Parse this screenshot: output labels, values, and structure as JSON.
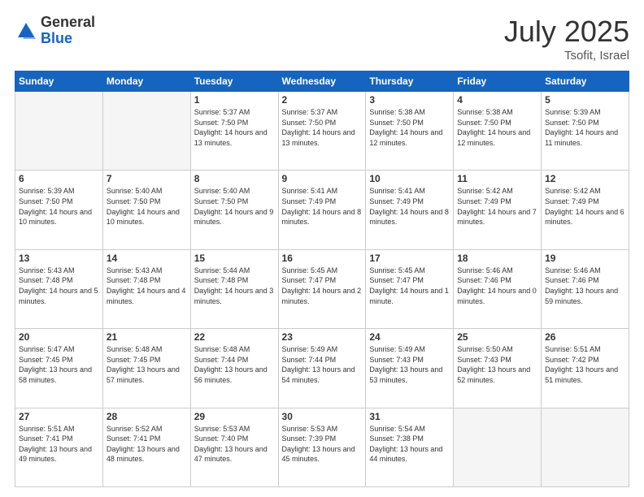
{
  "header": {
    "logo_general": "General",
    "logo_blue": "Blue",
    "title": "July 2025",
    "location": "Tsofit, Israel"
  },
  "days_of_week": [
    "Sunday",
    "Monday",
    "Tuesday",
    "Wednesday",
    "Thursday",
    "Friday",
    "Saturday"
  ],
  "weeks": [
    [
      {
        "day": "",
        "info": ""
      },
      {
        "day": "",
        "info": ""
      },
      {
        "day": "1",
        "info": "Sunrise: 5:37 AM\nSunset: 7:50 PM\nDaylight: 14 hours and 13 minutes."
      },
      {
        "day": "2",
        "info": "Sunrise: 5:37 AM\nSunset: 7:50 PM\nDaylight: 14 hours and 13 minutes."
      },
      {
        "day": "3",
        "info": "Sunrise: 5:38 AM\nSunset: 7:50 PM\nDaylight: 14 hours and 12 minutes."
      },
      {
        "day": "4",
        "info": "Sunrise: 5:38 AM\nSunset: 7:50 PM\nDaylight: 14 hours and 12 minutes."
      },
      {
        "day": "5",
        "info": "Sunrise: 5:39 AM\nSunset: 7:50 PM\nDaylight: 14 hours and 11 minutes."
      }
    ],
    [
      {
        "day": "6",
        "info": "Sunrise: 5:39 AM\nSunset: 7:50 PM\nDaylight: 14 hours and 10 minutes."
      },
      {
        "day": "7",
        "info": "Sunrise: 5:40 AM\nSunset: 7:50 PM\nDaylight: 14 hours and 10 minutes."
      },
      {
        "day": "8",
        "info": "Sunrise: 5:40 AM\nSunset: 7:50 PM\nDaylight: 14 hours and 9 minutes."
      },
      {
        "day": "9",
        "info": "Sunrise: 5:41 AM\nSunset: 7:49 PM\nDaylight: 14 hours and 8 minutes."
      },
      {
        "day": "10",
        "info": "Sunrise: 5:41 AM\nSunset: 7:49 PM\nDaylight: 14 hours and 8 minutes."
      },
      {
        "day": "11",
        "info": "Sunrise: 5:42 AM\nSunset: 7:49 PM\nDaylight: 14 hours and 7 minutes."
      },
      {
        "day": "12",
        "info": "Sunrise: 5:42 AM\nSunset: 7:49 PM\nDaylight: 14 hours and 6 minutes."
      }
    ],
    [
      {
        "day": "13",
        "info": "Sunrise: 5:43 AM\nSunset: 7:48 PM\nDaylight: 14 hours and 5 minutes."
      },
      {
        "day": "14",
        "info": "Sunrise: 5:43 AM\nSunset: 7:48 PM\nDaylight: 14 hours and 4 minutes."
      },
      {
        "day": "15",
        "info": "Sunrise: 5:44 AM\nSunset: 7:48 PM\nDaylight: 14 hours and 3 minutes."
      },
      {
        "day": "16",
        "info": "Sunrise: 5:45 AM\nSunset: 7:47 PM\nDaylight: 14 hours and 2 minutes."
      },
      {
        "day": "17",
        "info": "Sunrise: 5:45 AM\nSunset: 7:47 PM\nDaylight: 14 hours and 1 minute."
      },
      {
        "day": "18",
        "info": "Sunrise: 5:46 AM\nSunset: 7:46 PM\nDaylight: 14 hours and 0 minutes."
      },
      {
        "day": "19",
        "info": "Sunrise: 5:46 AM\nSunset: 7:46 PM\nDaylight: 13 hours and 59 minutes."
      }
    ],
    [
      {
        "day": "20",
        "info": "Sunrise: 5:47 AM\nSunset: 7:45 PM\nDaylight: 13 hours and 58 minutes."
      },
      {
        "day": "21",
        "info": "Sunrise: 5:48 AM\nSunset: 7:45 PM\nDaylight: 13 hours and 57 minutes."
      },
      {
        "day": "22",
        "info": "Sunrise: 5:48 AM\nSunset: 7:44 PM\nDaylight: 13 hours and 56 minutes."
      },
      {
        "day": "23",
        "info": "Sunrise: 5:49 AM\nSunset: 7:44 PM\nDaylight: 13 hours and 54 minutes."
      },
      {
        "day": "24",
        "info": "Sunrise: 5:49 AM\nSunset: 7:43 PM\nDaylight: 13 hours and 53 minutes."
      },
      {
        "day": "25",
        "info": "Sunrise: 5:50 AM\nSunset: 7:43 PM\nDaylight: 13 hours and 52 minutes."
      },
      {
        "day": "26",
        "info": "Sunrise: 5:51 AM\nSunset: 7:42 PM\nDaylight: 13 hours and 51 minutes."
      }
    ],
    [
      {
        "day": "27",
        "info": "Sunrise: 5:51 AM\nSunset: 7:41 PM\nDaylight: 13 hours and 49 minutes."
      },
      {
        "day": "28",
        "info": "Sunrise: 5:52 AM\nSunset: 7:41 PM\nDaylight: 13 hours and 48 minutes."
      },
      {
        "day": "29",
        "info": "Sunrise: 5:53 AM\nSunset: 7:40 PM\nDaylight: 13 hours and 47 minutes."
      },
      {
        "day": "30",
        "info": "Sunrise: 5:53 AM\nSunset: 7:39 PM\nDaylight: 13 hours and 45 minutes."
      },
      {
        "day": "31",
        "info": "Sunrise: 5:54 AM\nSunset: 7:38 PM\nDaylight: 13 hours and 44 minutes."
      },
      {
        "day": "",
        "info": ""
      },
      {
        "day": "",
        "info": ""
      }
    ]
  ]
}
